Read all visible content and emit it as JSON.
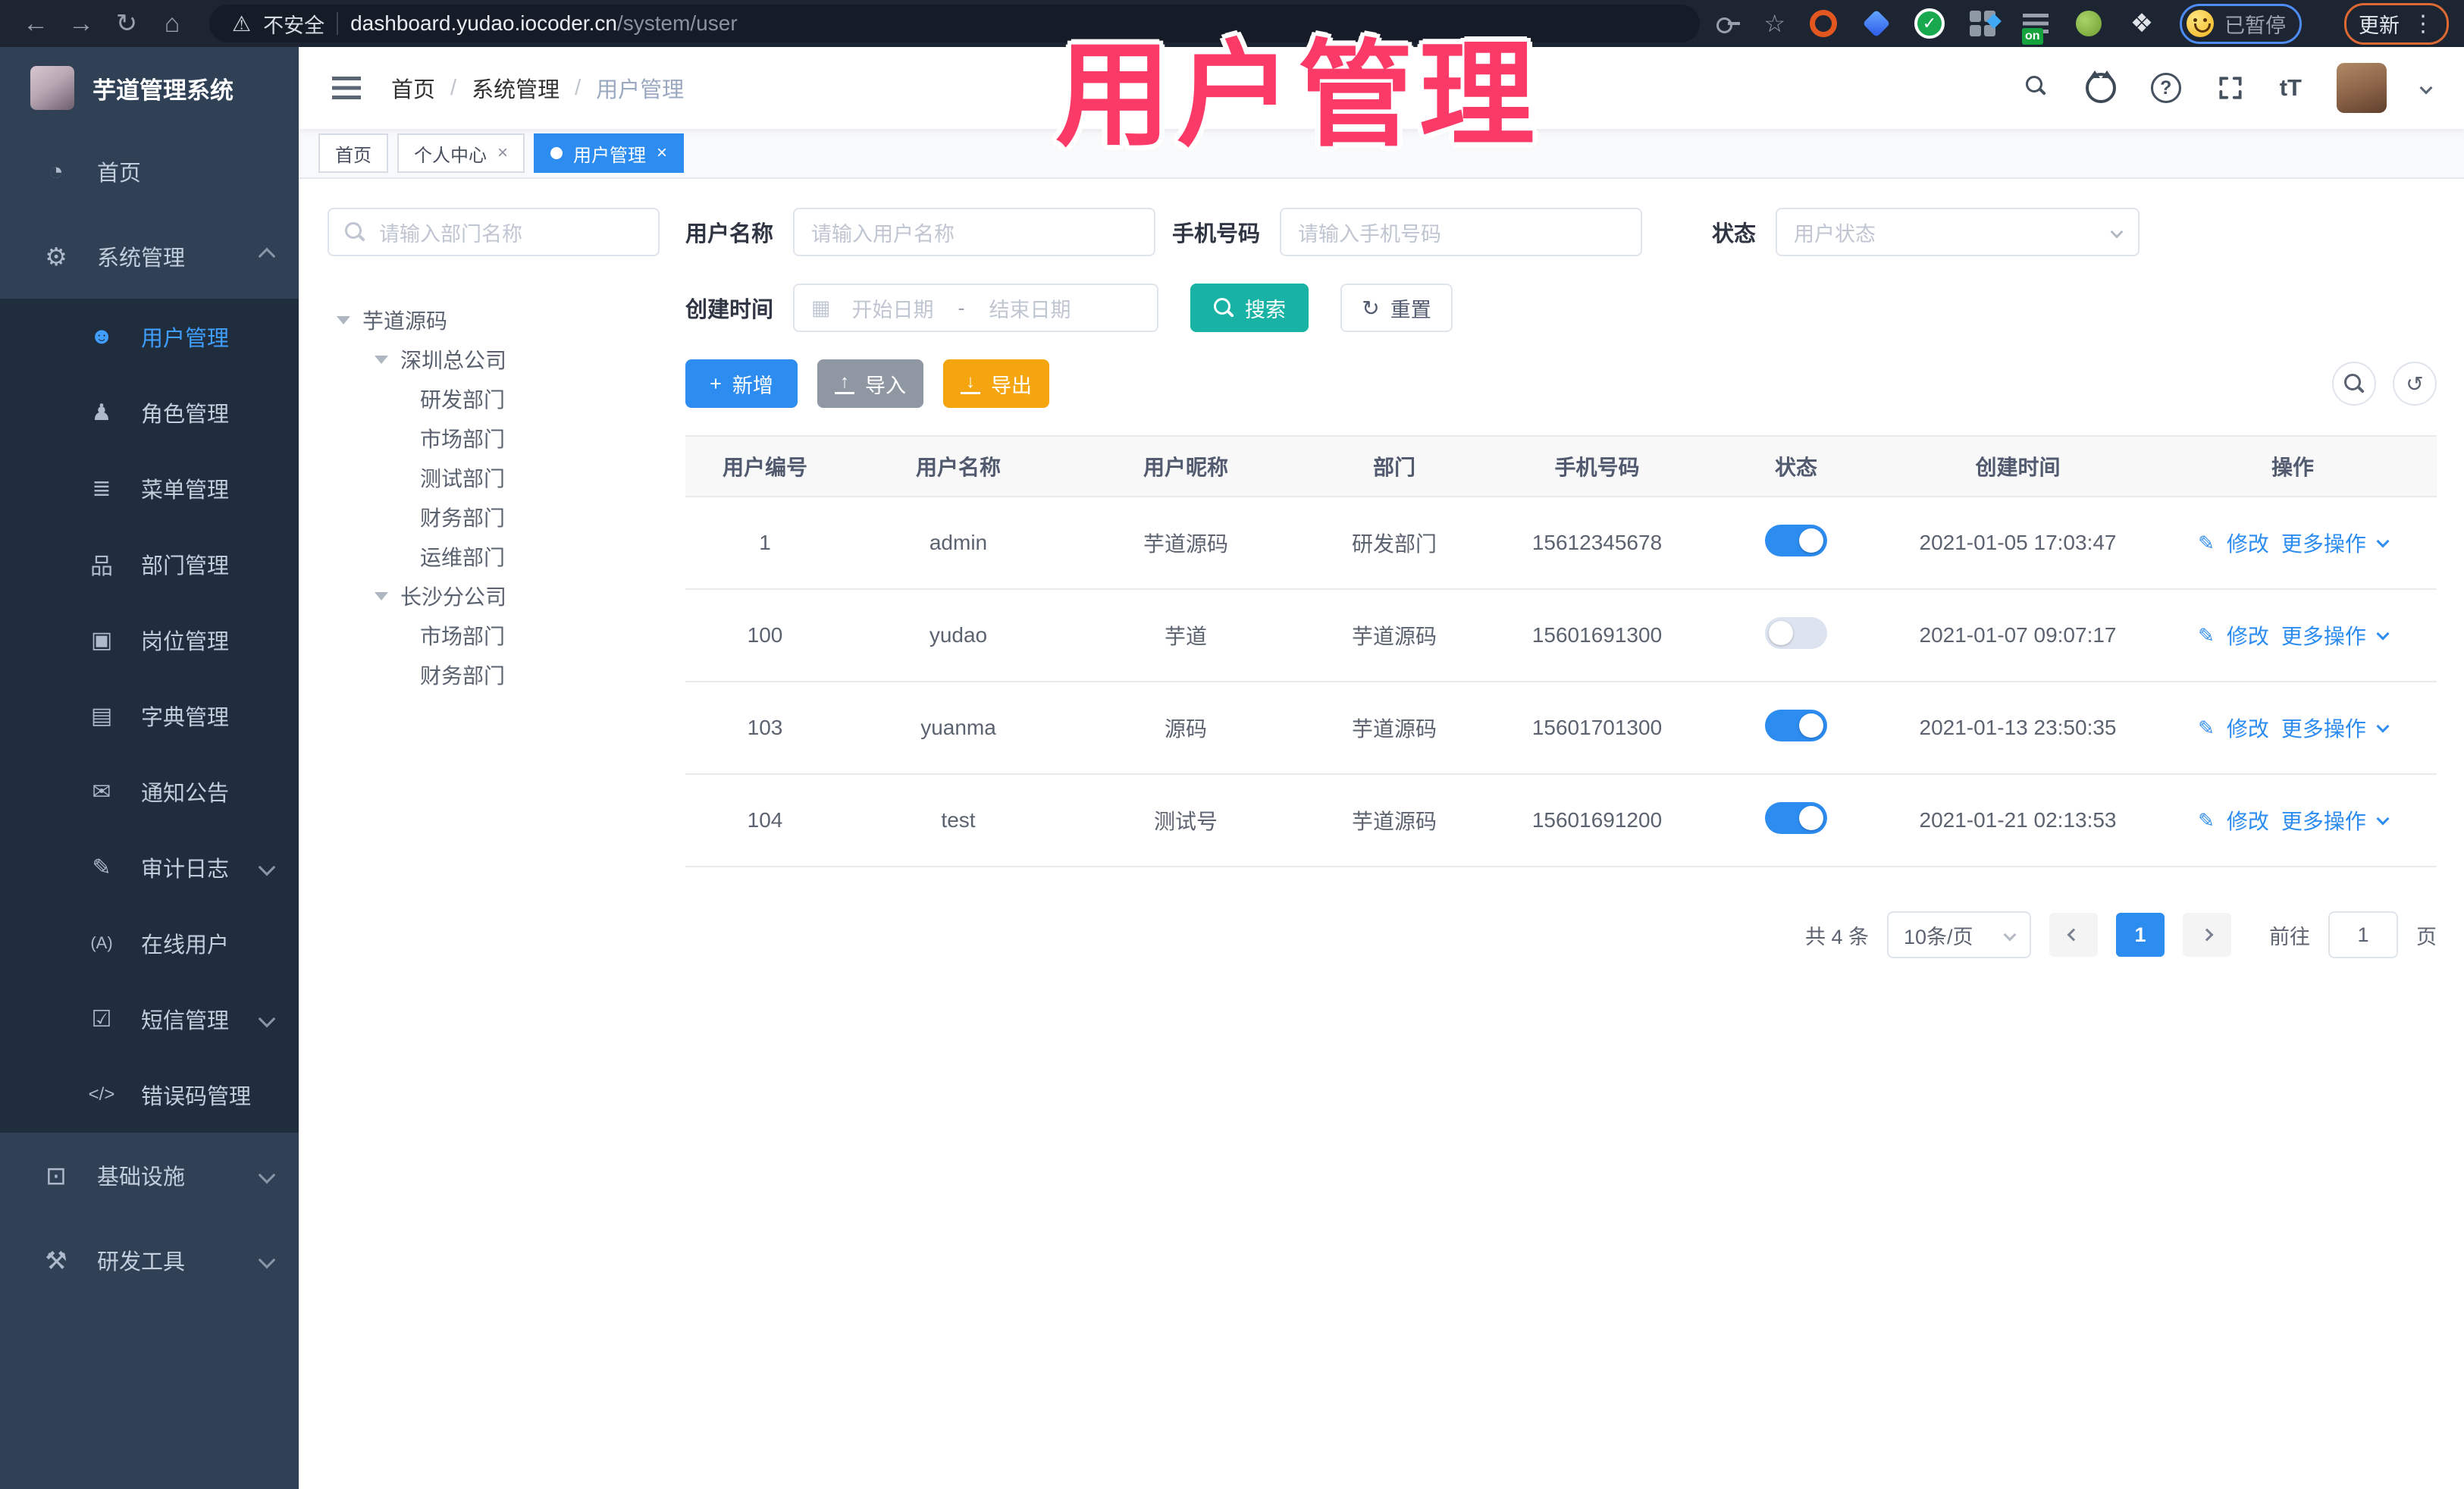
{
  "browser": {
    "security_label": "不安全",
    "url_host": "dashboard.yudao.iocoder.cn",
    "url_path": "/system/user",
    "extension_on_badge": "on",
    "profile_badge": "已暂停",
    "update_label": "更新"
  },
  "overlay": {
    "title": "用户管理"
  },
  "sidebar": {
    "app_title": "芋道管理系统",
    "home": {
      "label": "首页",
      "glyph": "◔"
    },
    "system": {
      "label": "系统管理",
      "glyph": "⚙"
    },
    "system_children": [
      {
        "label": "用户管理",
        "glyph": "☻"
      },
      {
        "label": "角色管理",
        "glyph": "♟"
      },
      {
        "label": "菜单管理",
        "glyph": "≣"
      },
      {
        "label": "部门管理",
        "glyph": "品"
      },
      {
        "label": "岗位管理",
        "glyph": "▣"
      },
      {
        "label": "字典管理",
        "glyph": "▤"
      },
      {
        "label": "通知公告",
        "glyph": "✉"
      },
      {
        "label": "审计日志",
        "glyph": "✎"
      },
      {
        "label": "在线用户",
        "glyph": "(A)"
      },
      {
        "label": "短信管理",
        "glyph": "☑"
      },
      {
        "label": "错误码管理",
        "glyph": "</>"
      }
    ],
    "infra": {
      "label": "基础设施",
      "glyph": "⊡"
    },
    "devtools": {
      "label": "研发工具",
      "glyph": "⚒"
    }
  },
  "header": {
    "breadcrumb": [
      "首页",
      "系统管理",
      "用户管理"
    ],
    "breadcrumb_sep": "/",
    "help_glyph": "?",
    "font_size_glyph": "tT"
  },
  "tabs": [
    {
      "label": "首页"
    },
    {
      "label": "个人中心"
    },
    {
      "label": "用户管理"
    }
  ],
  "ui": {
    "close_glyph": "×",
    "back_glyph": "←",
    "forward_glyph": "→",
    "reload_glyph": "↻",
    "home_glyph": "⌂",
    "warn_glyph": "⚠",
    "star_glyph": "☆",
    "puzzle_glyph": "❖",
    "vdots_glyph": "⋮",
    "check_glyph": "✓",
    "calendar_glyph": "▦",
    "plus_glyph": "+",
    "arrow_up_glyph": "↑",
    "arrow_down_glyph": "↓",
    "refresh_glyph": "↻",
    "refresh2_glyph": "↺",
    "pencil_glyph": "✎"
  },
  "dept": {
    "search_placeholder": "请输入部门名称",
    "tree": [
      {
        "label": "芋道源码"
      },
      {
        "label": "深圳总公司"
      },
      {
        "label": "研发部门"
      },
      {
        "label": "市场部门"
      },
      {
        "label": "测试部门"
      },
      {
        "label": "财务部门"
      },
      {
        "label": "运维部门"
      },
      {
        "label": "长沙分公司"
      },
      {
        "label": "市场部门"
      },
      {
        "label": "财务部门"
      }
    ]
  },
  "filters": {
    "username_label": "用户名称",
    "username_placeholder": "请输入用户名称",
    "mobile_label": "手机号码",
    "mobile_placeholder": "请输入手机号码",
    "status_label": "状态",
    "status_placeholder": "用户状态",
    "created_label": "创建时间",
    "start_placeholder": "开始日期",
    "range_separator": "-",
    "end_placeholder": "结束日期",
    "search_label": "搜索",
    "reset_label": "重置"
  },
  "toolbar": {
    "add_label": "新增",
    "import_label": "导入",
    "export_label": "导出"
  },
  "table": {
    "columns": [
      "用户编号",
      "用户名称",
      "用户昵称",
      "部门",
      "手机号码",
      "状态",
      "创建时间",
      "操作"
    ],
    "actions": {
      "edit": "修改",
      "more": "更多操作"
    },
    "rows": [
      {
        "id": "1",
        "username": "admin",
        "nickname": "芋道源码",
        "dept": "研发部门",
        "mobile": "15612345678",
        "status": "on",
        "created": "2021-01-05 17:03:47"
      },
      {
        "id": "100",
        "username": "yudao",
        "nickname": "芋道",
        "dept": "芋道源码",
        "mobile": "15601691300",
        "status": "off",
        "created": "2021-01-07 09:07:17"
      },
      {
        "id": "103",
        "username": "yuanma",
        "nickname": "源码",
        "dept": "芋道源码",
        "mobile": "15601701300",
        "status": "on",
        "created": "2021-01-13 23:50:35"
      },
      {
        "id": "104",
        "username": "test",
        "nickname": "测试号",
        "dept": "芋道源码",
        "mobile": "15601691200",
        "status": "on",
        "created": "2021-01-21 02:13:53"
      }
    ]
  },
  "pagination": {
    "total_label": "共 4 条",
    "page_size_label": "10条/页",
    "current_page": "1",
    "goto_label": "前往",
    "goto_value": "1",
    "unit_label": "页"
  },
  "colors": {
    "accent": "#409eff",
    "search_teal": "#18b3a4",
    "export_amber": "#f5a60f",
    "menu_bg": "#304156",
    "submenu_bg": "#1f2d3d",
    "overlay_pink": "#fb3a67"
  }
}
